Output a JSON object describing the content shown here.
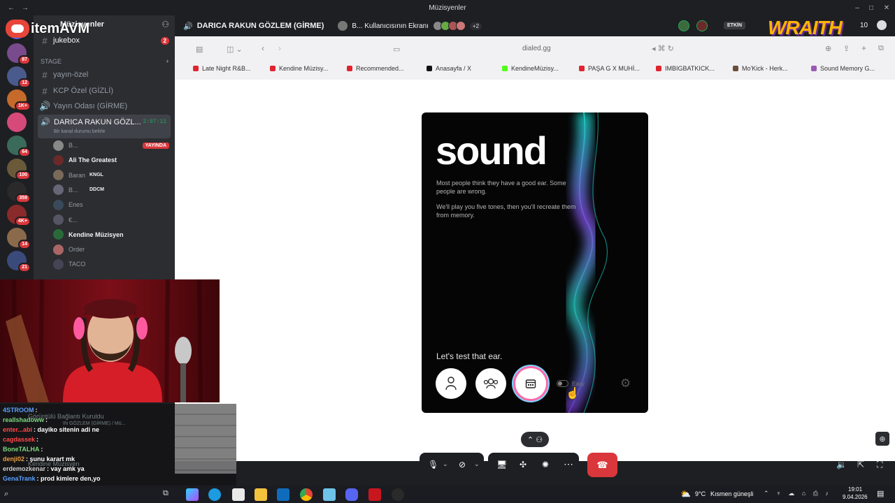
{
  "window": {
    "title": "Müzisyenler"
  },
  "overlay_brand": "itemAVM",
  "wraith_brand": "WRAITH",
  "server": {
    "name": "Müzisyenler"
  },
  "servers": [
    {
      "badge": "87",
      "color": "#7a4b8c"
    },
    {
      "badge": "12",
      "color": "#4a5a8c"
    },
    {
      "badge": "1K+",
      "color": "#c56a2a"
    },
    {
      "badge": "",
      "color": "#d64a7a"
    },
    {
      "badge": "64",
      "color": "#3a6a5a"
    },
    {
      "badge": "100",
      "color": "#6a5a3a"
    },
    {
      "badge": "359",
      "color": "#2a2a2a"
    },
    {
      "badge": "4K+",
      "color": "#8a2a2a"
    },
    {
      "badge": "14",
      "color": "#8a6a4a"
    },
    {
      "badge": "21",
      "color": "#3a4a7a"
    }
  ],
  "channels": {
    "jukebox": {
      "label": "jukebox",
      "badge": "2"
    },
    "category": "STAGE",
    "items": [
      {
        "label": "yayın-özel"
      },
      {
        "label": "KCP Özel (GİZLİ)"
      },
      {
        "label": "Yayın Odası (GİRME)"
      }
    ],
    "active": {
      "label": "DARICA RAKUN GÖZL...",
      "time": "2:07:11",
      "status": "Bir kanal durumu belirle"
    },
    "users": [
      {
        "name": "B...",
        "tag": "YAYINDA"
      },
      {
        "name": "Ali The Greatest"
      },
      {
        "name": "Baran",
        "extra": "KNGL"
      },
      {
        "name": "B...",
        "extra": "DDCM"
      },
      {
        "name": "Enes"
      },
      {
        "name": "€..."
      },
      {
        "name": "Kendine Müzisyen"
      },
      {
        "name": "Order"
      },
      {
        "name": "TACO"
      }
    ]
  },
  "header": {
    "channel": "DARICA RAKUN GÖZLEM (GİRME)",
    "screen_title": "B... Kullanıcısının Ekranı",
    "extra_count": "+2",
    "etkin": "ETKİN",
    "viewers": "10"
  },
  "browser": {
    "url": "dialed.gg",
    "tabs": [
      {
        "label": "Late Night R&B...",
        "color": "#e0242f"
      },
      {
        "label": "Kendine Müzisy...",
        "color": "#e0242f"
      },
      {
        "label": "Recommended...",
        "color": "#e0242f"
      },
      {
        "label": "Anasayfa / X",
        "color": "#111111"
      },
      {
        "label": "KendineMüzisy...",
        "color": "#53fc18"
      },
      {
        "label": "PAŞA G X MUHİ...",
        "color": "#e0242f"
      },
      {
        "label": "IMBIGBATKICK...",
        "color": "#e0242f"
      },
      {
        "label": "Mo'Kick - Herk...",
        "color": "#6b4d3a"
      },
      {
        "label": "Sound Memory G...",
        "color": "#9b59b6"
      }
    ]
  },
  "app": {
    "title": "sound",
    "p1": "Most people think they have a good ear. Some people are wrong.",
    "p2": "We'll play you five tones, then you'll recreate them from memory.",
    "cta": "Let's test that ear.",
    "difficulty": "Easy"
  },
  "call": {
    "connected": "Görüntülü Bağlantı Kuruldu",
    "sub": "IN GÖZLEM (GİRME) / Mü...",
    "user": "Kendine Müzisyen"
  },
  "chat": [
    {
      "user": "4STROOM",
      "msg": ":",
      "color": "#5aa0ff"
    },
    {
      "user": "reallshadoww",
      "msg": ":",
      "color": "#7dd87d"
    },
    {
      "user": "enter...abi",
      "msg": ": dayiko sitenin adi ne",
      "color": "#ff4a4a"
    },
    {
      "user": "cagdassek",
      "msg": ":",
      "color": "#ff4a4a"
    },
    {
      "user": "BoneTALHA",
      "msg": ":",
      "color": "#7dd87d"
    },
    {
      "user": "denji02",
      "msg": ": şunu karart mk",
      "color": "#f0a040"
    },
    {
      "user": "erdemozkenar",
      "msg": ": vay amk ya",
      "color": "#cfcfcf"
    },
    {
      "user": "GenaTrank",
      "msg": ": prod kimlere den,yo",
      "color": "#5aa0ff"
    }
  ],
  "taskbar": {
    "weather": "9°C",
    "weather_text": "Kısmen güneşli",
    "time": "19:01",
    "date": "9.04.2026"
  }
}
